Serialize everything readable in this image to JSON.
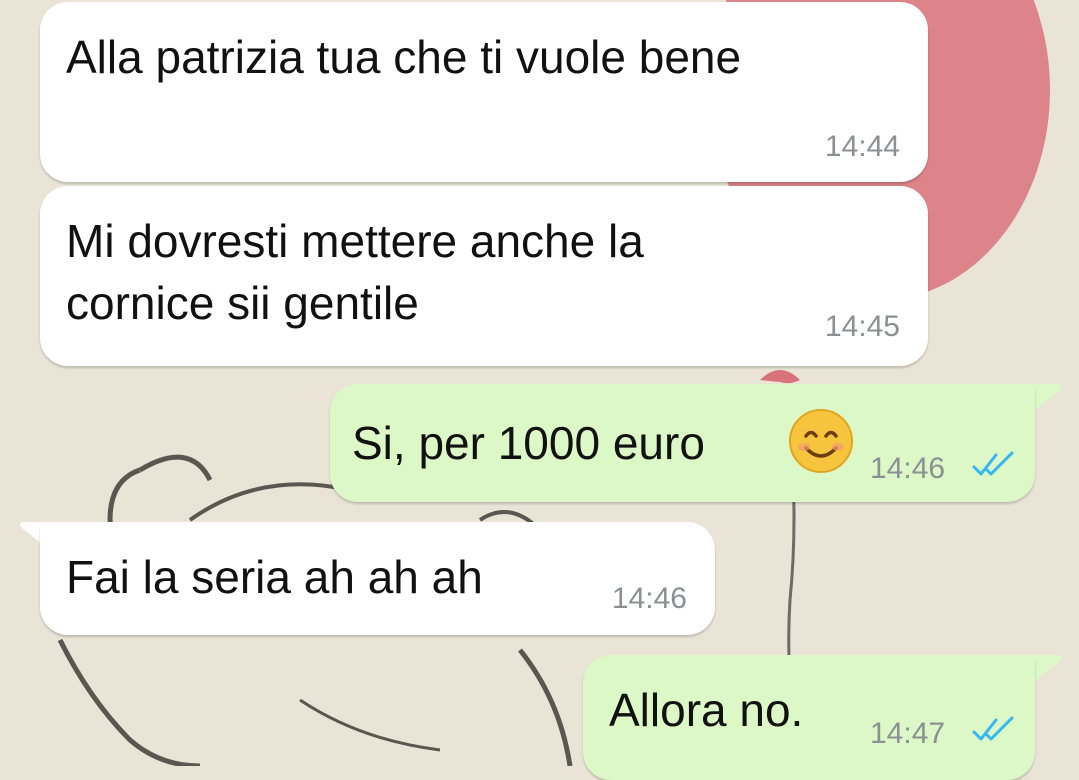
{
  "colors": {
    "incoming_bubble": "#ffffff",
    "outgoing_bubble": "#dcf8c6",
    "timestamp": "#8c8f93",
    "read_ticks": "#34b7f1",
    "chat_background": "#e9e4d6"
  },
  "messages": [
    {
      "direction": "incoming",
      "text": "Alla patrizia tua che ti vuole bene",
      "time": "14:44"
    },
    {
      "direction": "incoming",
      "text": "Mi dovresti mettere anche la\ncornice sii gentile",
      "time": "14:45"
    },
    {
      "direction": "outgoing",
      "text": "Si, per 1000 euro",
      "emoji": "smiling-face-icon",
      "time": "14:46",
      "status": "read"
    },
    {
      "direction": "incoming",
      "text": "Fai la seria ah ah ah",
      "time": "14:46"
    },
    {
      "direction": "outgoing",
      "text": "Allora no.",
      "time": "14:47",
      "status": "read"
    }
  ]
}
